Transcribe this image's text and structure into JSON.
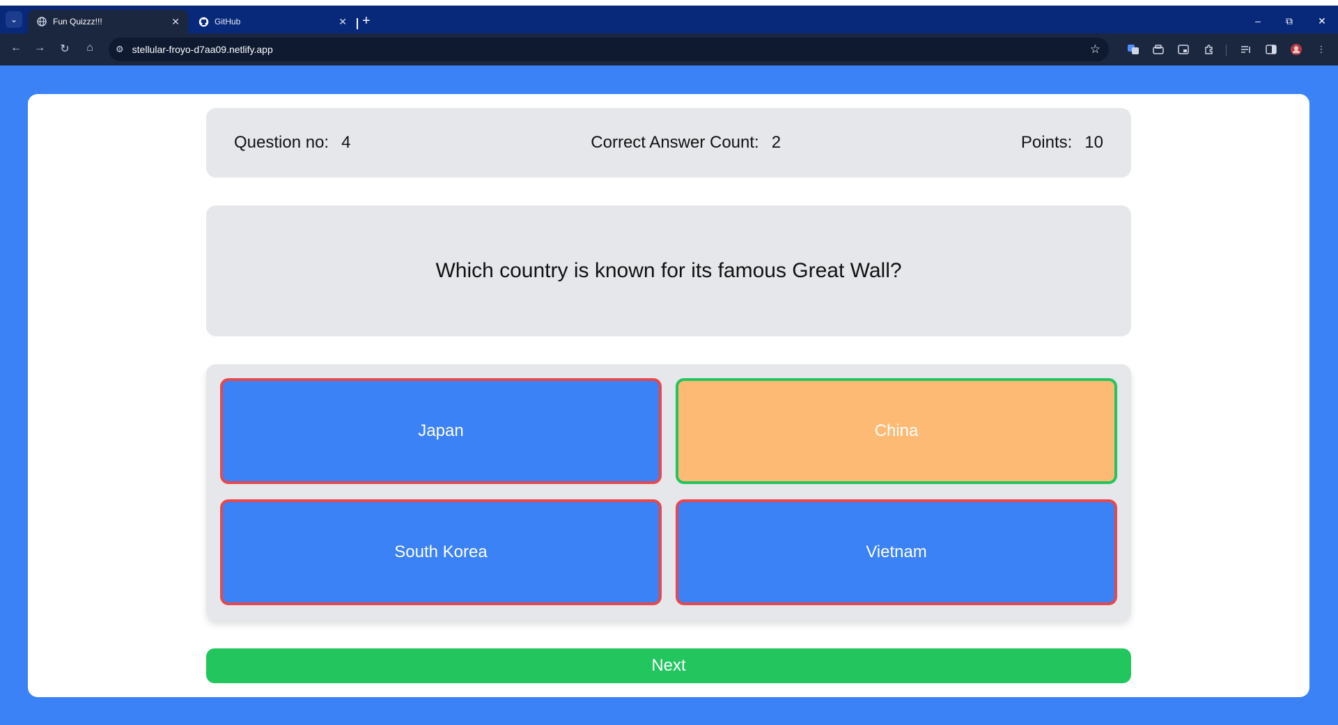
{
  "browser": {
    "tabs": [
      {
        "title": "Fun Quizzz!!!",
        "icon": "globe-icon"
      },
      {
        "title": "GitHub",
        "icon": "github-icon"
      }
    ],
    "url": "stellular-froyo-d7aa09.netlify.app"
  },
  "stats": {
    "question_label": "Question no:",
    "question_value": "4",
    "correct_label": "Correct Answer Count:",
    "correct_value": "2",
    "points_label": "Points:",
    "points_value": "10"
  },
  "question": "Which country is known for its famous Great Wall?",
  "answers": [
    {
      "label": "Japan",
      "state": "incorrect"
    },
    {
      "label": "China",
      "state": "correct"
    },
    {
      "label": "South Korea",
      "state": "incorrect"
    },
    {
      "label": "Vietnam",
      "state": "incorrect"
    }
  ],
  "next_label": "Next",
  "colors": {
    "page_background": "#3b82f6",
    "answer_default": "#3b82f6",
    "answer_correct_fill": "#fdba74",
    "correct_border": "#22c55e",
    "incorrect_border": "#e5484d",
    "next_button": "#22c55e"
  }
}
